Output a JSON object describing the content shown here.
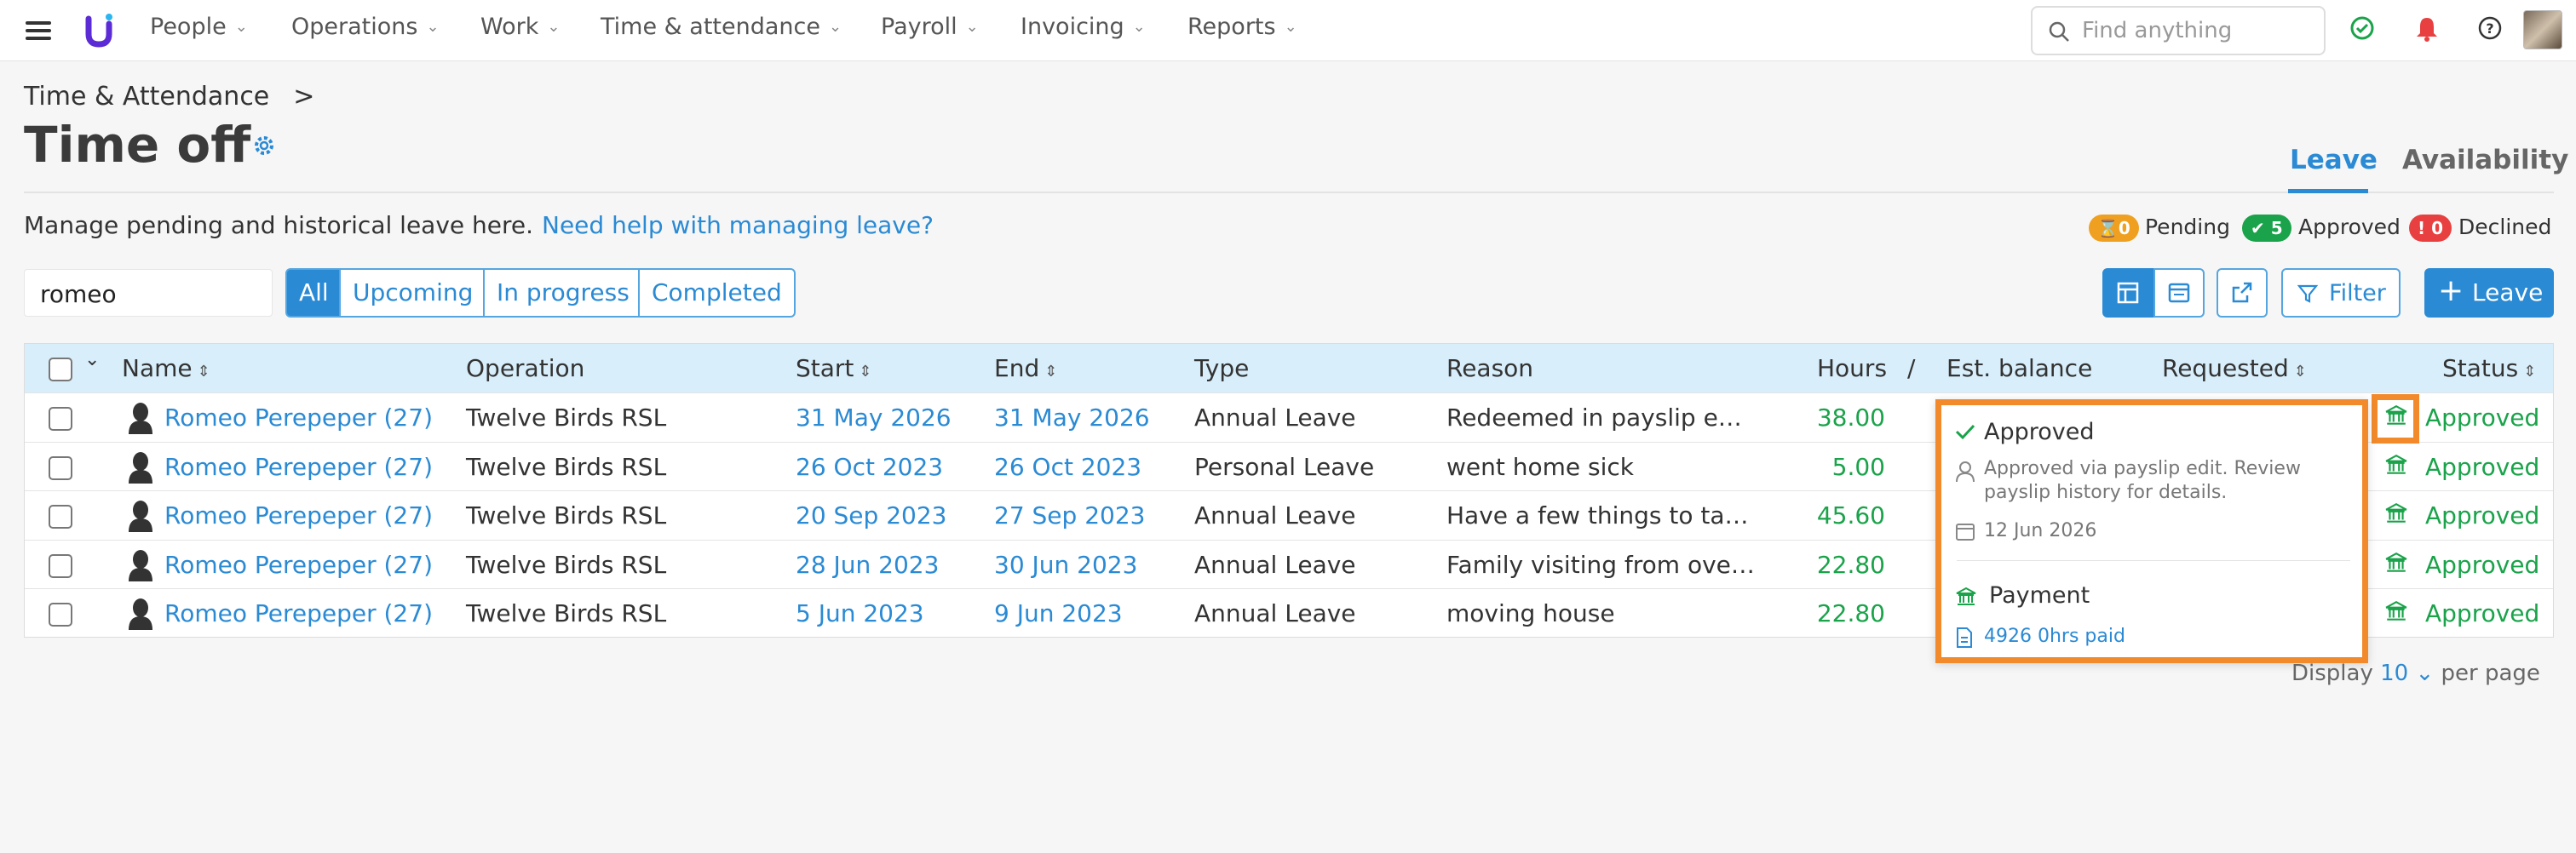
{
  "nav": {
    "items": [
      "People",
      "Operations",
      "Work",
      "Time & attendance",
      "Payroll",
      "Invoicing",
      "Reports"
    ],
    "search_placeholder": "Find anything"
  },
  "breadcrumb": {
    "parent": "Time & Attendance",
    "sep": ">"
  },
  "page": {
    "title": "Time off",
    "tabs": [
      "Leave",
      "Availability"
    ],
    "description": "Manage pending and historical leave here.",
    "help_link": "Need help with managing leave?"
  },
  "counts": {
    "pending_count": "0",
    "pending_label": "Pending",
    "approved_count": "5",
    "approved_label": "Approved",
    "declined_count": "0",
    "declined_label": "Declined"
  },
  "filter": {
    "search_value": "romeo",
    "segments": [
      "All",
      "Upcoming",
      "In progress",
      "Completed"
    ],
    "filter_label": "Filter",
    "leave_label": "Leave"
  },
  "table": {
    "headers": {
      "name": "Name",
      "operation": "Operation",
      "start": "Start",
      "end": "End",
      "type": "Type",
      "reason": "Reason",
      "hours": "Hours",
      "slash": "/",
      "balance": "Est. balance",
      "requested": "Requested",
      "status": "Status"
    },
    "rows": [
      {
        "name": "Romeo Perepeper (27)",
        "operation": "Twelve Birds RSL",
        "start": "31 May 2026",
        "end": "31 May 2026",
        "type": "Annual Leave",
        "reason": "Redeemed in payslip e…",
        "hours": "38.00",
        "status": "Approved"
      },
      {
        "name": "Romeo Perepeper (27)",
        "operation": "Twelve Birds RSL",
        "start": "26 Oct 2023",
        "end": "26 Oct 2023",
        "type": "Personal Leave",
        "reason": "went home sick",
        "hours": "5.00",
        "status": "Approved"
      },
      {
        "name": "Romeo Perepeper (27)",
        "operation": "Twelve Birds RSL",
        "start": "20 Sep 2023",
        "end": "27 Sep 2023",
        "type": "Annual Leave",
        "reason": "Have a few things to ta…",
        "hours": "45.60",
        "status": "Approved"
      },
      {
        "name": "Romeo Perepeper (27)",
        "operation": "Twelve Birds RSL",
        "start": "28 Jun 2023",
        "end": "30 Jun 2023",
        "type": "Annual Leave",
        "reason": "Family visiting from ove…",
        "hours": "22.80",
        "status": "Approved"
      },
      {
        "name": "Romeo Perepeper (27)",
        "operation": "Twelve Birds RSL",
        "start": "5 Jun 2023",
        "end": "9 Jun 2023",
        "type": "Annual Leave",
        "reason": "moving house",
        "hours": "22.80",
        "status": "Approved"
      }
    ]
  },
  "popup": {
    "status": "Approved",
    "note_line1": "Approved via payslip edit. Review",
    "note_line2": "payslip history for details.",
    "date": "12 Jun 2026",
    "payment_title": "Payment",
    "payment_detail": "4926 0hrs paid"
  },
  "pagination": {
    "display_label": "Display",
    "per_page_value": "10",
    "per_page_label": "per page"
  },
  "colors": {
    "accent": "#2a8ad4",
    "approved": "#1aa34a",
    "pending": "#f0a020",
    "declined": "#e84040",
    "highlight": "#f28a2b"
  }
}
